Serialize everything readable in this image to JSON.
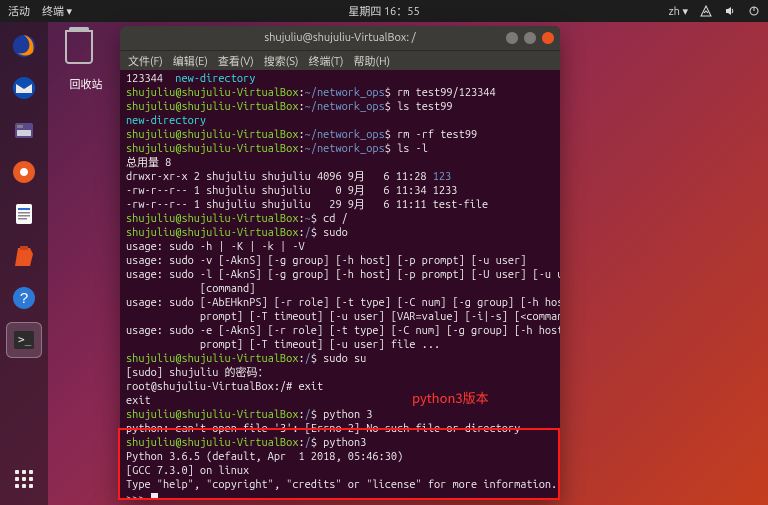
{
  "topbar": {
    "activities": "活动",
    "app_menu": "终端 ▾",
    "clock": "星期四 16：55",
    "lang": "zh ▾",
    "net_icon": "network-icon",
    "sound_icon": "sound-icon",
    "power_icon": "power-icon"
  },
  "desktop": {
    "trash_label": "回收站"
  },
  "dock": {
    "items": [
      "firefox",
      "thunderbird",
      "files",
      "rhythmbox",
      "writer",
      "software",
      "help",
      "terminal"
    ]
  },
  "window": {
    "title": "shujuliu@shujuliu-VirtualBox: /",
    "menu": {
      "file": "文件(F)",
      "edit": "编辑(E)",
      "view": "查看(V)",
      "search": "搜索(S)",
      "terminal": "终端(T)",
      "help": "帮助(H)"
    }
  },
  "term": {
    "l1a": "123344  ",
    "l1b": "new-directory",
    "u": "shujuliu@shujuliu-VirtualBox",
    "c": ":",
    "path_netops": "~/network_ops",
    "path_home": "~",
    "path_root": "/",
    "l2cmd": "$ rm test99/123344",
    "l3cmd": "$ ls test99",
    "l4": "new-directory",
    "l5cmd": "$ rm -rf test99",
    "l6cmd": "$ ls -l",
    "l7": "总用量 8",
    "l8a": "drwxr-xr-x 2 shujuliu shujuliu 4096 9月   6 11:28 ",
    "l8b": "123",
    "l9": "-rw-r--r-- 1 shujuliu shujuliu    0 9月   6 11:34 1233",
    "l10": "-rw-r--r-- 1 shujuliu shujuliu   29 9月   6 11:11 test-file",
    "l11cmd": "$ cd /",
    "l12cmd": "$ sudo",
    "l13": "usage: sudo -h | -K | -k | -V",
    "l14": "usage: sudo -v [-AknS] [-g group] [-h host] [-p prompt] [-u user]",
    "l15": "usage: sudo -l [-AknS] [-g group] [-h host] [-p prompt] [-U user] [-u user]",
    "l15b": "            [command]",
    "l16": "usage: sudo [-AbEHknPS] [-r role] [-t type] [-C num] [-g group] [-h host] [-p",
    "l16b": "            prompt] [-T timeout] [-u user] [VAR=value] [-i|-s] [<command>]",
    "l17": "usage: sudo -e [-AknS] [-r role] [-t type] [-C num] [-g group] [-h host] [-p",
    "l17b": "            prompt] [-T timeout] [-u user] file ...",
    "l18cmd": "$ sudo su",
    "l19": "[sudo] shujuliu 的密码：",
    "l20": "root@shujuliu-VirtualBox:/# exit",
    "l21": "exit",
    "l22cmd": "$ python 3",
    "l23": "python: can't open file '3': [Errno 2] No such file or directory",
    "l24cmd": "$ python3",
    "l25": "Python 3.6.5 (default, Apr  1 2018, 05:46:30)",
    "l26": "[GCC 7.3.0] on linux",
    "l27": "Type \"help\", \"copyright\", \"credits\" or \"license\" for more information.",
    "l28": ">>> "
  },
  "annotation": {
    "text": "python3版本"
  }
}
